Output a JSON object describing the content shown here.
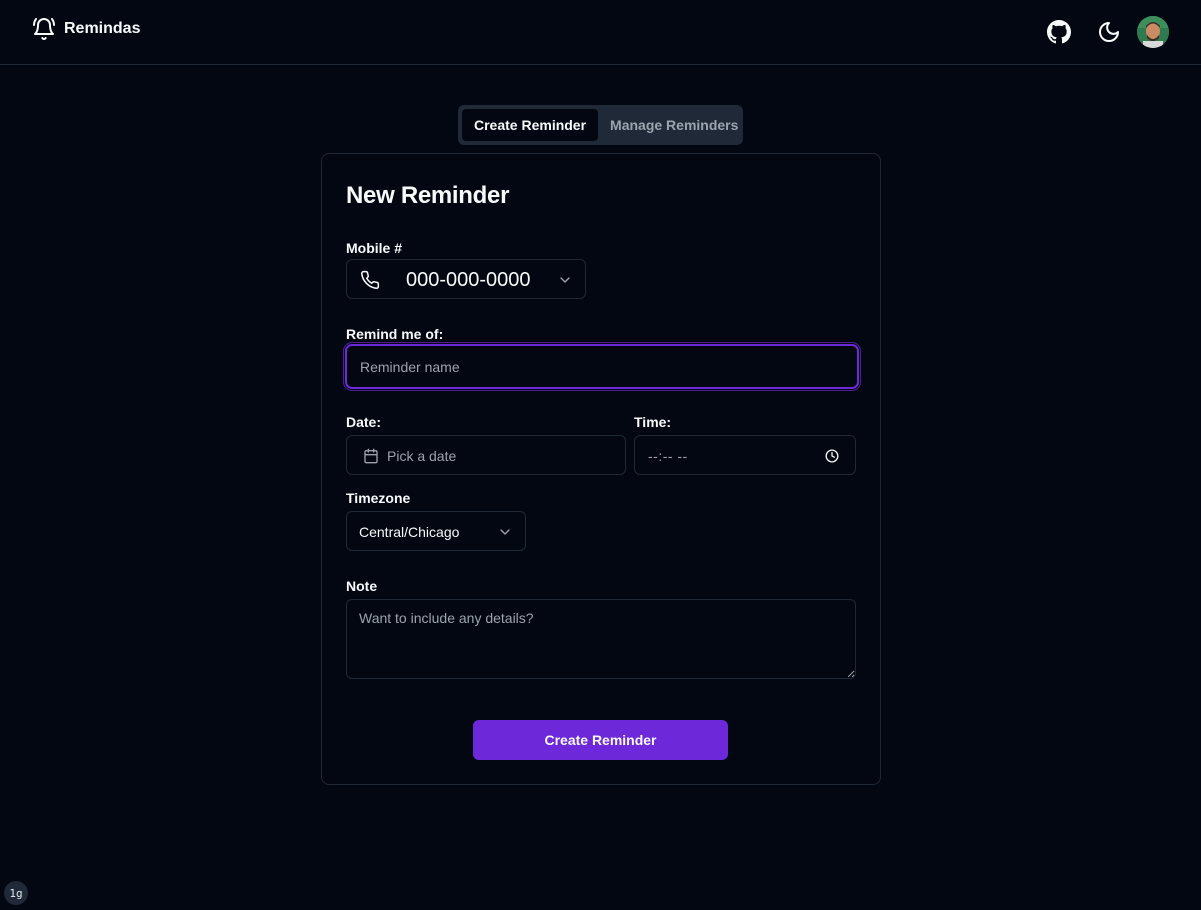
{
  "header": {
    "app_name": "Remindas",
    "icons": [
      "bell-ring-icon",
      "github-icon",
      "moon-icon",
      "avatar"
    ]
  },
  "tabs": [
    {
      "label": "Create Reminder",
      "active": true
    },
    {
      "label": "Manage Reminders",
      "active": false
    }
  ],
  "form": {
    "title": "New Reminder",
    "mobile": {
      "label": "Mobile #",
      "value": "000-000-0000",
      "icon": "phone-icon"
    },
    "remind": {
      "label": "Remind me of:",
      "placeholder": "Reminder name"
    },
    "date": {
      "label": "Date:",
      "placeholder": "Pick a date",
      "icon": "calendar-icon"
    },
    "time": {
      "label": "Time:",
      "value": "--:-- --",
      "icon": "clock-icon"
    },
    "timezone": {
      "label": "Timezone",
      "value": "Central/Chicago"
    },
    "note": {
      "label": "Note",
      "placeholder": "Want to include any details?"
    },
    "submit_label": "Create Reminder"
  },
  "corner_badge": "1g",
  "colors": {
    "background": "#030712",
    "border": "#1f2937",
    "accent": "#6d28d9",
    "muted_text": "#9ca3af"
  }
}
